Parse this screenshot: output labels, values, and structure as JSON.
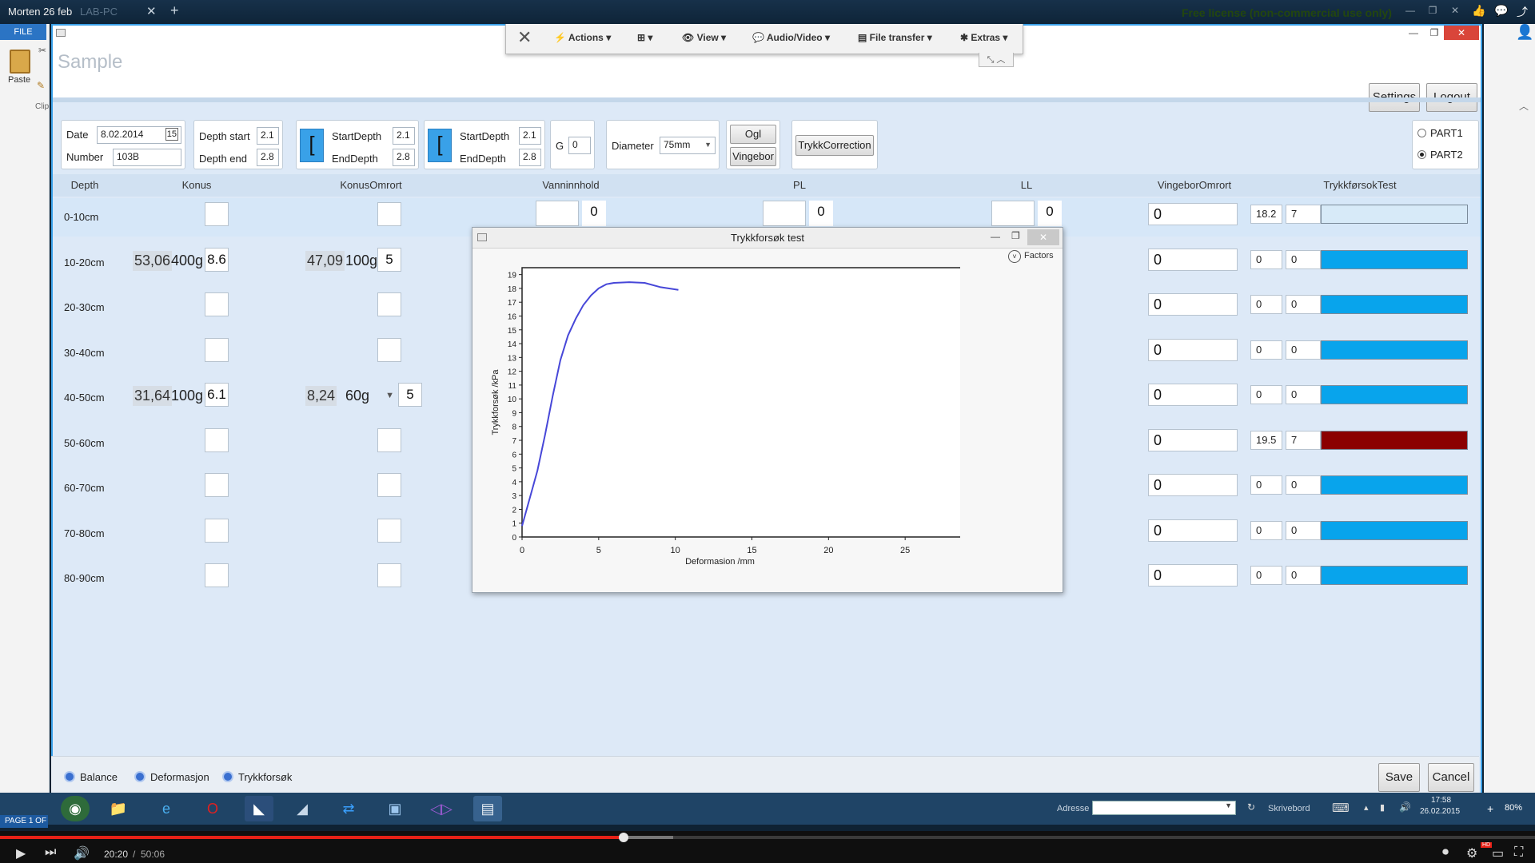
{
  "topbar": {
    "title": "Morten 26 feb",
    "tab": "LAB-PC",
    "tab_close": "✕",
    "new_tab": "+",
    "license": "Free license (non-commercial use only)"
  },
  "office": {
    "file": "FILE",
    "paste": "Paste",
    "clipboard": "Clip"
  },
  "remote_toolbar": {
    "close": "✕",
    "actions": "Actions",
    "view": "View",
    "audio_video": "Audio/Video",
    "file_transfer": "File transfer",
    "extras": "Extras"
  },
  "app": {
    "title": "Sample",
    "settings": "Settings",
    "logout": "Logout",
    "part1": "PART1",
    "part2": "PART2",
    "part_selected": "PART2"
  },
  "params": {
    "date_label": "Date",
    "date_value": "8.02.2014",
    "number_label": "Number",
    "number_value": "103B",
    "depth_start_label": "Depth start",
    "depth_start_value": "2.1",
    "depth_end_label": "Depth end",
    "depth_end_value": "2.8",
    "g1": {
      "start_label": "StartDepth",
      "start_value": "2.1",
      "end_label": "EndDepth",
      "end_value": "2.8"
    },
    "g2": {
      "start_label": "StartDepth",
      "start_value": "2.1",
      "end_label": "EndDepth",
      "end_value": "2.8"
    },
    "g_label": "G",
    "g_value": "0",
    "diameter_label": "Diameter",
    "diameter_value": "75mm",
    "ogl": "Ogl",
    "vingebor": "Vingebor",
    "trykk_correction": "TrykkCorrection"
  },
  "columns": [
    "Depth",
    "Konus",
    "KonusOmrort",
    "Vanninnhold",
    "PL",
    "LL",
    "VingeborOmrort",
    "TrykkførsokTest"
  ],
  "rows": [
    {
      "depth": "0-10cm",
      "konus_val": "",
      "konus_weight": "",
      "konus_box": "",
      "ko_val": "",
      "ko_weight": "",
      "ko_box": "",
      "vann": "0",
      "pl": "0",
      "ll": "0",
      "vbo": "0",
      "tf1": "18.2",
      "tf2": "7",
      "tf_color": "#d7eaf8"
    },
    {
      "depth": "10-20cm",
      "konus_val": "53,06",
      "konus_weight": "400g",
      "konus_box": "8.6",
      "ko_val": "47,09",
      "ko_weight": "100g",
      "ko_box": "5",
      "vann": "",
      "pl": "",
      "ll": "",
      "vbo": "0",
      "tf1": "0",
      "tf2": "0",
      "tf_color": "#08a4ec"
    },
    {
      "depth": "20-30cm",
      "konus_val": "",
      "konus_weight": "",
      "konus_box": "",
      "ko_val": "",
      "ko_weight": "",
      "ko_box": "",
      "vann": "",
      "pl": "",
      "ll": "",
      "vbo": "0",
      "tf1": "0",
      "tf2": "0",
      "tf_color": "#08a4ec"
    },
    {
      "depth": "30-40cm",
      "konus_val": "",
      "konus_weight": "",
      "konus_box": "",
      "ko_val": "",
      "ko_weight": "",
      "ko_box": "",
      "vann": "",
      "pl": "",
      "ll": "",
      "vbo": "0",
      "tf1": "0",
      "tf2": "0",
      "tf_color": "#08a4ec"
    },
    {
      "depth": "40-50cm",
      "konus_val": "31,64",
      "konus_weight": "100g",
      "konus_box": "6.1",
      "ko_val": "8,24",
      "ko_weight": "60g",
      "ko_box": "5",
      "vann": "",
      "pl": "",
      "ll": "",
      "vbo": "0",
      "tf1": "0",
      "tf2": "0",
      "tf_color": "#08a4ec"
    },
    {
      "depth": "50-60cm",
      "konus_val": "",
      "konus_weight": "",
      "konus_box": "",
      "ko_val": "",
      "ko_weight": "",
      "ko_box": "",
      "vann": "",
      "pl": "",
      "ll": "",
      "vbo": "0",
      "tf1": "19.5",
      "tf2": "7",
      "tf_color": "#8b0000"
    },
    {
      "depth": "60-70cm",
      "konus_val": "",
      "konus_weight": "",
      "konus_box": "",
      "ko_val": "",
      "ko_weight": "",
      "ko_box": "",
      "vann": "",
      "pl": "",
      "ll": "",
      "vbo": "0",
      "tf1": "0",
      "tf2": "0",
      "tf_color": "#08a4ec"
    },
    {
      "depth": "70-80cm",
      "konus_val": "",
      "konus_weight": "",
      "konus_box": "",
      "ko_val": "",
      "ko_weight": "",
      "ko_box": "",
      "vann": "",
      "pl": "",
      "ll": "",
      "vbo": "0",
      "tf1": "0",
      "tf2": "0",
      "tf_color": "#08a4ec"
    },
    {
      "depth": "80-90cm",
      "konus_val": "",
      "konus_weight": "",
      "konus_box": "",
      "ko_val": "",
      "ko_weight": "",
      "ko_box": "",
      "vann": "",
      "pl": "",
      "ll": "",
      "vbo": "0",
      "tf1": "0",
      "tf2": "0",
      "tf_color": "#08a4ec"
    }
  ],
  "dialog": {
    "title": "Trykkforsøk test",
    "factors": "Factors"
  },
  "chart_data": {
    "type": "line",
    "title": "",
    "xlabel": "Deformasion /mm",
    "ylabel": "Trykkforsøk /kPa",
    "xlim": [
      0,
      30
    ],
    "ylim": [
      0,
      19.5
    ],
    "xticks": [
      0,
      5,
      10,
      15,
      20,
      25,
      30
    ],
    "yticks": [
      0,
      1,
      2,
      3,
      4,
      5,
      6,
      7,
      8,
      9,
      10,
      11,
      12,
      13,
      14,
      15,
      16,
      17,
      18,
      19
    ],
    "line_color": "#4747d8",
    "grid": false,
    "series": [
      {
        "x": [
          0,
          0.5,
          1,
          1.5,
          2,
          2.5,
          3,
          3.5,
          4,
          4.5,
          5,
          5.5,
          6,
          7,
          8,
          9,
          10.2
        ],
        "y": [
          0.8,
          2.8,
          4.8,
          7.4,
          10.2,
          12.8,
          14.6,
          15.8,
          16.8,
          17.5,
          18.0,
          18.3,
          18.4,
          18.45,
          18.4,
          18.1,
          17.9
        ]
      }
    ]
  },
  "bottom": {
    "legend": [
      {
        "label": "Balance",
        "color": "#3a6fd0"
      },
      {
        "label": "Deformasjon",
        "color": "#3a6fd0"
      },
      {
        "label": "Trykkforsøk",
        "color": "#3a6fd0"
      }
    ],
    "save": "Save",
    "cancel": "Cancel"
  },
  "taskbar": {
    "adresse_label": "Adresse",
    "skrivebord": "Skrivebord",
    "time": "17:58",
    "date": "26.02.2015",
    "page": "PAGE 1 OF",
    "zoom": "80%"
  },
  "player": {
    "current": "20:20",
    "duration": "50:06",
    "progress": 0.406
  }
}
